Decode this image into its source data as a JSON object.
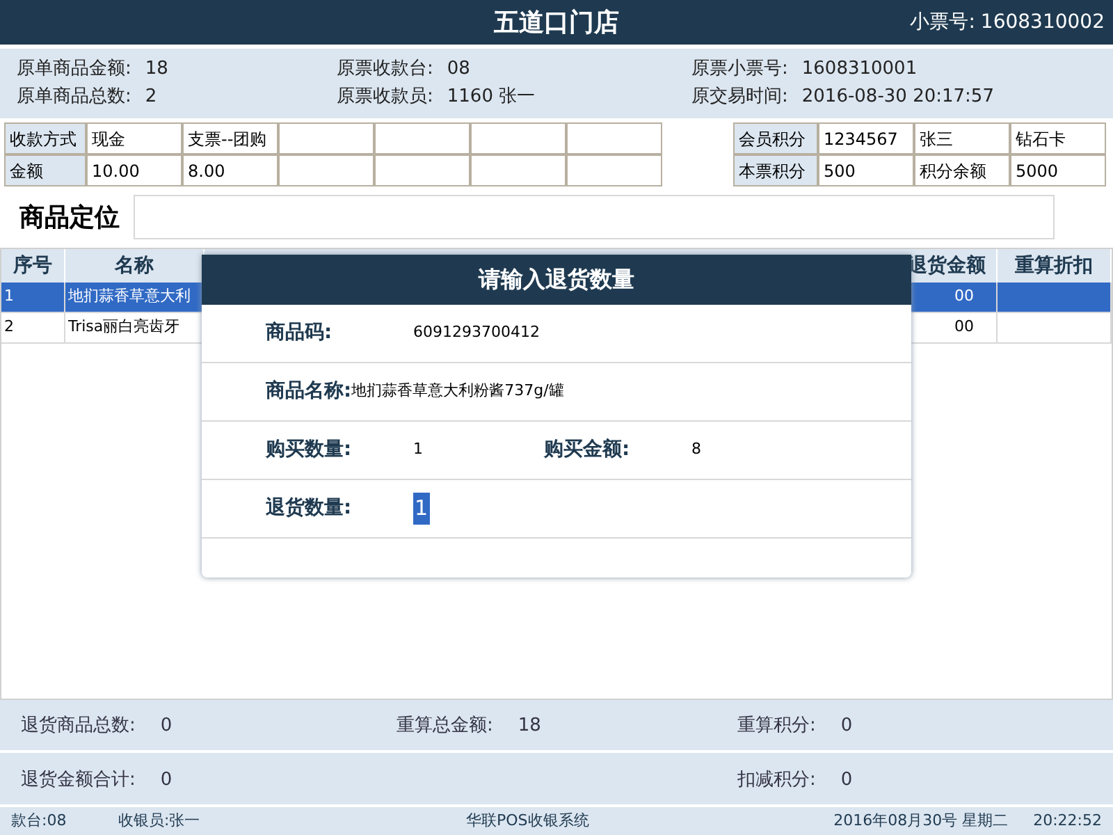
{
  "header": {
    "store": "五道口门店",
    "ticket_label": "小票号:",
    "ticket_no": "1608310002"
  },
  "info": [
    {
      "label": "原单商品金额:",
      "value": "18"
    },
    {
      "label": "原票收款台:",
      "value": "08"
    },
    {
      "label": "原票小票号:",
      "value": "1608310001"
    },
    {
      "label": "原单商品总数:",
      "value": "2"
    },
    {
      "label": "原票收款员:",
      "value": "1160 张一"
    },
    {
      "label": "原交易时间:",
      "value": "2016-08-30 20:17:57"
    }
  ],
  "payment_table": {
    "rows": [
      [
        "收款方式",
        "现金",
        "支票--团购",
        "",
        "",
        "",
        ""
      ],
      [
        "金额",
        "10.00",
        "8.00",
        "",
        "",
        "",
        ""
      ]
    ]
  },
  "points_table": {
    "rows": [
      [
        "会员积分",
        "1234567",
        "张三",
        "钻石卡"
      ],
      [
        "本票积分",
        "500",
        "积分余额",
        "5000"
      ]
    ]
  },
  "locate": {
    "label": "商品定位"
  },
  "items_table": {
    "columns": [
      "序号",
      "名称",
      "退货金额",
      "重算折扣"
    ],
    "rows": [
      {
        "cells": [
          "1",
          "地扪蒜香草意大利",
          "00",
          ""
        ],
        "selected": true
      },
      {
        "cells": [
          "2",
          "Trisa丽白亮齿牙",
          "00",
          ""
        ],
        "selected": false
      }
    ]
  },
  "dialog": {
    "title": "请输入退货数量",
    "rows": [
      [
        {
          "label": "商品码:",
          "value": "6091293700412"
        }
      ],
      [
        {
          "label": "商品名称:",
          "value": "地扪蒜香草意大利粉酱737g/罐"
        }
      ],
      [
        {
          "label": "购买数量:",
          "value": "1"
        },
        {
          "label": "购买金额:",
          "value": "8"
        }
      ],
      [
        {
          "label": "退货数量:",
          "value": "1",
          "kind": "input"
        }
      ]
    ]
  },
  "summary": [
    [
      {
        "label": "退货商品总数:",
        "value": "0"
      },
      {
        "label": "重算总金额:",
        "value": "18"
      },
      {
        "label": "重算积分:",
        "value": "0"
      }
    ],
    [
      {
        "label": "退货金额合计:",
        "value": "0"
      },
      {
        "label": "扣减积分:",
        "value": "0"
      }
    ]
  ],
  "status_bar": {
    "register": "款台:08",
    "cashier": "收银员:张一",
    "system": "华联POS收银系统",
    "date": "2016年08月30号 星期二",
    "time": "20:22:52"
  }
}
